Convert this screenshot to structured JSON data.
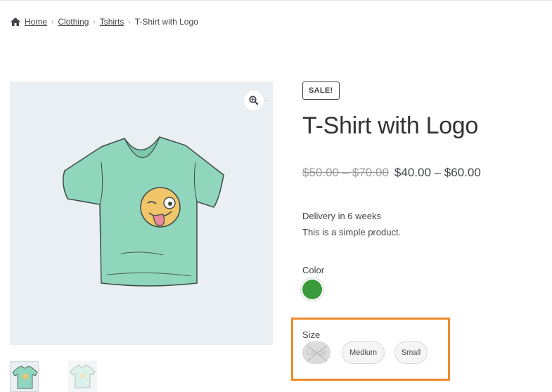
{
  "breadcrumb": {
    "items": [
      "Home",
      "Clothing",
      "Tshirts"
    ],
    "current": "T-Shirt with Logo"
  },
  "gallery": {
    "zoom_icon": "zoom-in-icon",
    "zoom_label": "."
  },
  "product": {
    "badge": "SALE!",
    "title": "T-Shirt with Logo",
    "price_old": "$50.00 – $70.00",
    "price_new": "$40.00 – $60.00",
    "description_lines": [
      "Delivery in 6 weeks",
      "This is a simple product."
    ]
  },
  "variations": {
    "color_label": "Color",
    "color_swatch": "#3a9b3a",
    "size_label": "Size",
    "sizes": [
      {
        "label": "Large",
        "available": false
      },
      {
        "label": "Medium",
        "available": true
      },
      {
        "label": "Small",
        "available": true
      }
    ]
  },
  "colors": {
    "highlight": "#f08b2b",
    "text": "#43454b",
    "gallery_bg": "#e9eff2",
    "shirt": "#8fd6bd"
  }
}
